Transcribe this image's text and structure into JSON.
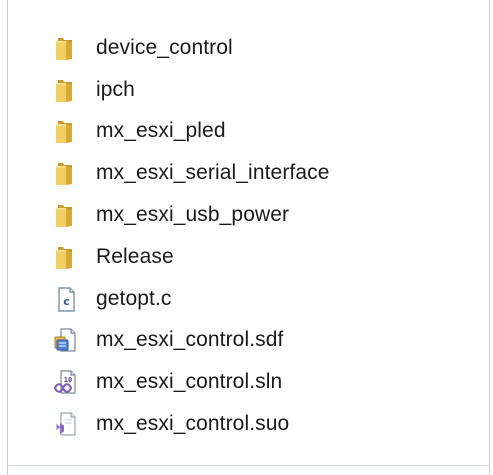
{
  "files": [
    {
      "name": "device_control",
      "type": "folder",
      "icon": "folder-icon"
    },
    {
      "name": "ipch",
      "type": "folder",
      "icon": "folder-icon"
    },
    {
      "name": "mx_esxi_pled",
      "type": "folder",
      "icon": "folder-icon"
    },
    {
      "name": "mx_esxi_serial_interface",
      "type": "folder",
      "icon": "folder-icon"
    },
    {
      "name": "mx_esxi_usb_power",
      "type": "folder",
      "icon": "folder-icon"
    },
    {
      "name": "Release",
      "type": "folder",
      "icon": "folder-icon"
    },
    {
      "name": "getopt.c",
      "type": "c-source",
      "icon": "c-source-file-icon"
    },
    {
      "name": "mx_esxi_control.sdf",
      "type": "sdf",
      "icon": "sdf-database-file-icon"
    },
    {
      "name": "mx_esxi_control.sln",
      "type": "sln",
      "icon": "visual-studio-solution-icon"
    },
    {
      "name": "mx_esxi_control.suo",
      "type": "suo",
      "icon": "visual-studio-options-file-icon"
    }
  ],
  "colors": {
    "folder_front": "#e8c04f",
    "folder_back": "#c9992c",
    "text": "#1a1a1a",
    "border": "#c8ccd2",
    "accent_blue": "#3b6fc4",
    "accent_purple": "#7c5cb5"
  }
}
